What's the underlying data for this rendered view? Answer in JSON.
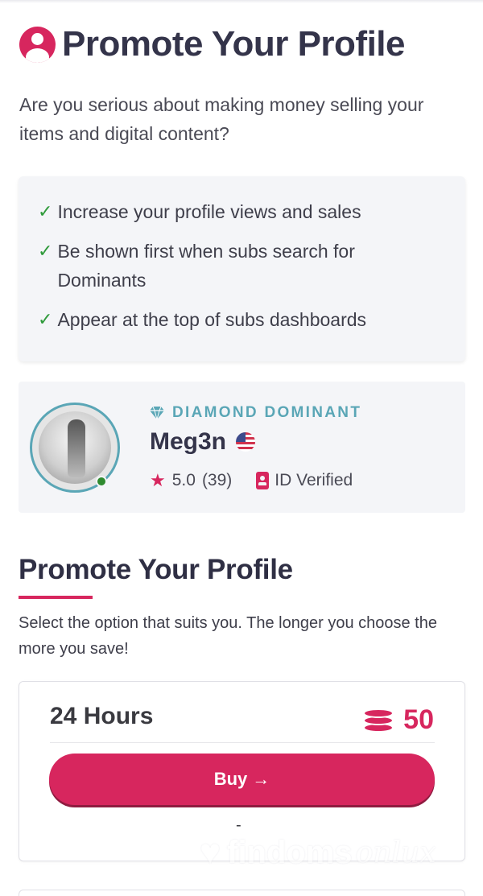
{
  "header": {
    "title": "Promote Your Profile",
    "icon": "user-circle-icon"
  },
  "intro": "Are you serious about making money selling your items and digital content?",
  "benefits": [
    {
      "text": "Increase your profile views and sales"
    },
    {
      "text": "Be shown first when subs search for Dominants"
    },
    {
      "text": "Appear at the top of subs dashboards"
    }
  ],
  "profile": {
    "tier": "DIAMOND DOMINANT",
    "username": "Meg3n",
    "rating": "5.0",
    "reviews": "(39)",
    "verified_label": "ID Verified",
    "country_flag": "us-flag-icon",
    "online": true
  },
  "section": {
    "title": "Promote Your Profile",
    "subtitle": "Select the option that suits you. The longer you choose the more you save!"
  },
  "options": [
    {
      "duration": "24 Hours",
      "price": "50",
      "buy_label": "Buy",
      "note": "-"
    }
  ],
  "watermark": {
    "brand": "findoms",
    "suffix": "onlux"
  },
  "colors": {
    "accent": "#d7265e",
    "diamond": "#5aa6b6",
    "check": "#2e9a3a",
    "panel": "#f4f5f8"
  }
}
